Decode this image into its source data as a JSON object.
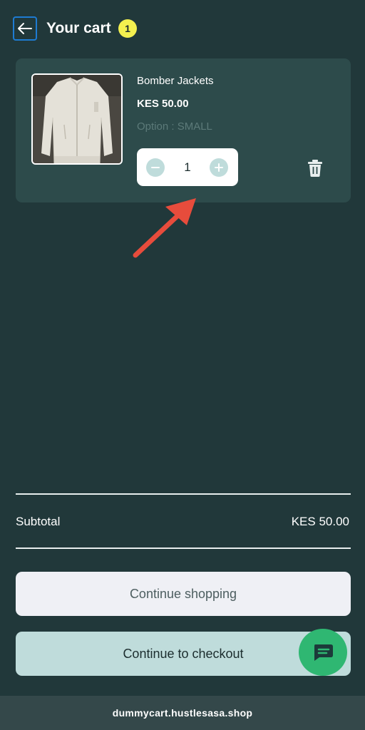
{
  "header": {
    "back_icon": "arrow-left-icon",
    "title": "Your cart",
    "item_count": "1"
  },
  "cart": {
    "items": [
      {
        "name": "Bomber Jackets",
        "price": "KES 50.00",
        "option": "Option : SMALL",
        "quantity": "1",
        "image": "white bomber jacket photo"
      }
    ]
  },
  "summary": {
    "subtotal_label": "Subtotal",
    "subtotal_value": "KES 50.00"
  },
  "actions": {
    "continue_shopping": "Continue shopping",
    "continue_checkout": "Continue to checkout"
  },
  "footer": {
    "domain": "dummycart.hustlesasa.shop"
  },
  "colors": {
    "background": "#21383a",
    "card": "#2d4b4b",
    "badge": "#f3f04f",
    "accent": "#bfdcdb",
    "chat_fab": "#2fb772",
    "annotation_arrow": "#e74c3c"
  }
}
